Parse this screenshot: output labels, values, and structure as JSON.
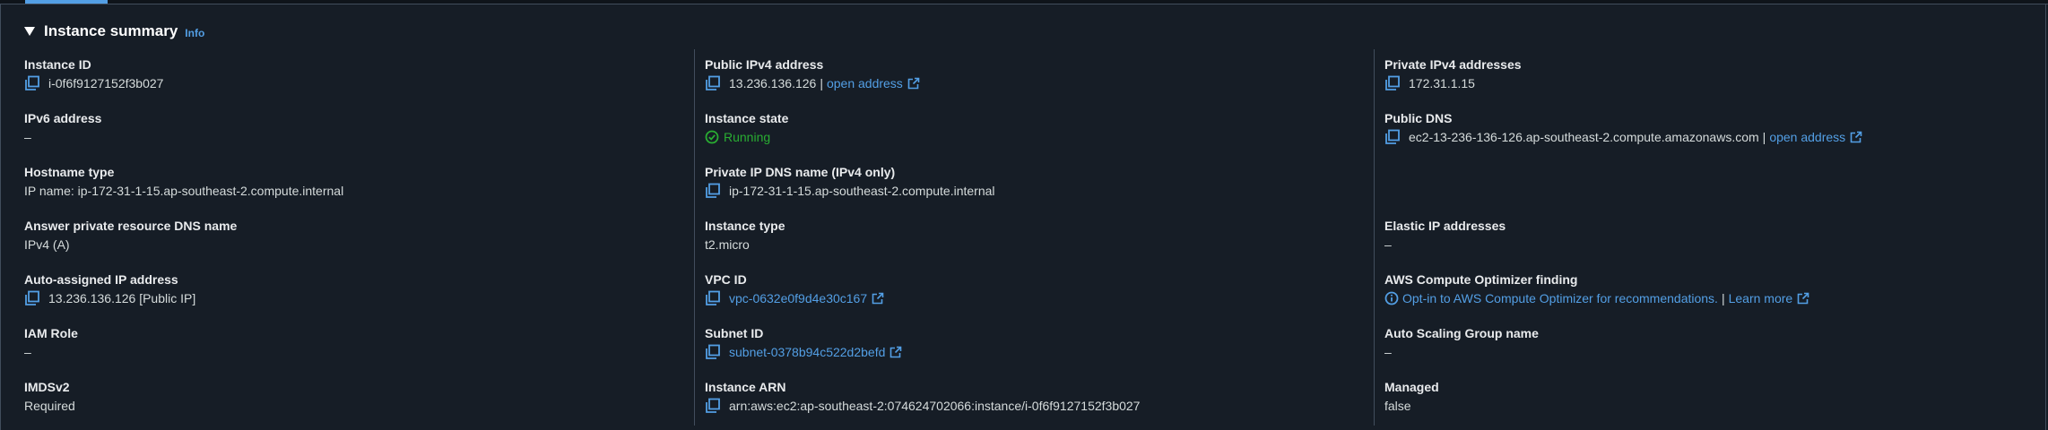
{
  "header": {
    "title": "Instance summary",
    "info": "Info"
  },
  "col1": {
    "instance_id": {
      "label": "Instance ID",
      "value": "i-0f6f9127152f3b027"
    },
    "ipv6": {
      "label": "IPv6 address",
      "value": "–"
    },
    "hostname_type": {
      "label": "Hostname type",
      "value": "IP name: ip-172-31-1-15.ap-southeast-2.compute.internal"
    },
    "answer_dns": {
      "label": "Answer private resource DNS name",
      "value": "IPv4 (A)"
    },
    "auto_ip": {
      "label": "Auto-assigned IP address",
      "value": "13.236.136.126 [Public IP]"
    },
    "iam_role": {
      "label": "IAM Role",
      "value": "–"
    },
    "imdsv2": {
      "label": "IMDSv2",
      "value": "Required"
    }
  },
  "col2": {
    "public_ipv4": {
      "label": "Public IPv4 address",
      "value": "13.236.136.126",
      "sep": "|",
      "link": "open address"
    },
    "instance_state": {
      "label": "Instance state",
      "value": "Running"
    },
    "private_ip_dns": {
      "label": "Private IP DNS name (IPv4 only)",
      "value": "ip-172-31-1-15.ap-southeast-2.compute.internal"
    },
    "instance_type": {
      "label": "Instance type",
      "value": "t2.micro"
    },
    "vpc_id": {
      "label": "VPC ID",
      "value": "vpc-0632e0f9d4e30c167"
    },
    "subnet_id": {
      "label": "Subnet ID",
      "value": "subnet-0378b94c522d2befd"
    },
    "instance_arn": {
      "label": "Instance ARN",
      "value": "arn:aws:ec2:ap-southeast-2:074624702066:instance/i-0f6f9127152f3b027"
    }
  },
  "col3": {
    "private_ipv4": {
      "label": "Private IPv4 addresses",
      "value": "172.31.1.15"
    },
    "public_dns": {
      "label": "Public DNS",
      "value": "ec2-13-236-136-126.ap-southeast-2.compute.amazonaws.com",
      "sep": "|",
      "link": "open address"
    },
    "elastic_ip": {
      "label": "Elastic IP addresses",
      "value": "–"
    },
    "optimizer": {
      "label": "AWS Compute Optimizer finding",
      "link": "Opt-in to AWS Compute Optimizer for recommendations.",
      "sep": "|",
      "learn": "Learn more"
    },
    "asg": {
      "label": "Auto Scaling Group name",
      "value": "–"
    },
    "managed": {
      "label": "Managed",
      "value": "false"
    }
  },
  "colors": {
    "background": "#161d26",
    "link": "#539fe5",
    "running": "#29ad32",
    "divider": "#414d5c"
  },
  "icons": {
    "copy": "copy-icon",
    "external": "external-link-icon",
    "status": "status-positive-icon",
    "info": "info-icon",
    "caret": "caret-down-icon"
  }
}
